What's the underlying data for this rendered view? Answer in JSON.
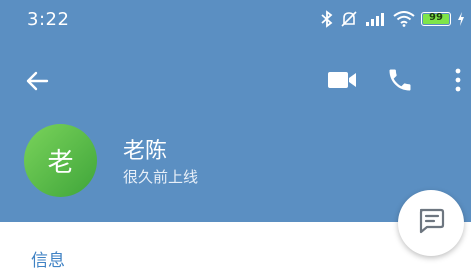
{
  "status_bar": {
    "time": "3:22",
    "battery_level": "99",
    "icons": [
      "bluetooth-icon",
      "mute-icon",
      "signal-icon",
      "wifi-icon",
      "battery-icon",
      "charging-icon"
    ]
  },
  "toolbar": {
    "icons": [
      "back-arrow-icon",
      "video-call-icon",
      "phone-icon",
      "more-vert-icon"
    ]
  },
  "profile": {
    "avatar_text": "老",
    "name": "老陈",
    "status": "很久前上线"
  },
  "fab": {
    "icon": "message-icon"
  },
  "info": {
    "title": "信息"
  },
  "colors": {
    "header": "#5b8fc2",
    "avatar_from": "#7ad35b",
    "avatar_to": "#3fa53a",
    "accent_text": "#3f82c4",
    "battery": "#7ee54a"
  }
}
